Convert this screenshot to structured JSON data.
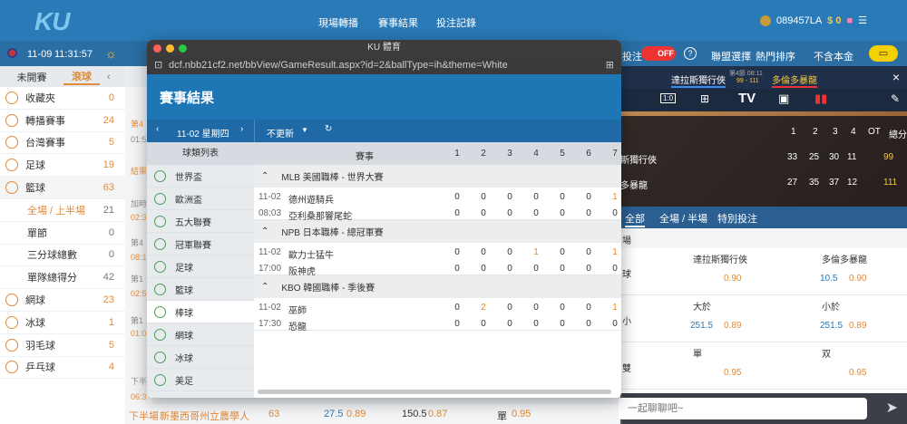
{
  "header": {
    "logo_a": "K",
    "logo_b": "U",
    "nav": [
      "現場轉播",
      "賽事結果",
      "投注記錄"
    ],
    "account": "089457LA",
    "money": "$ 0",
    "coin_label": "鋼"
  },
  "subbar": {
    "flag": "TW",
    "date": "11-09",
    "time": "11:31:57",
    "bet_label": "投注",
    "toggle": "OFF",
    "help": "?",
    "filter": "聯盟選擇",
    "sort": "熱門排序",
    "currency": "不含本金"
  },
  "sidebar": {
    "tab_upcoming": "未開賽",
    "tab_live": "滾球",
    "items": [
      {
        "label": "收藏夾",
        "count": "0",
        "icon": "star-icon"
      },
      {
        "label": "轉播賽事",
        "count": "24",
        "icon": "tv-icon"
      },
      {
        "label": "台灣賽事",
        "count": "5",
        "icon": "flag-icon"
      },
      {
        "label": "足球",
        "count": "19",
        "icon": "soccer-icon"
      },
      {
        "label": "籃球",
        "count": "63",
        "icon": "basketball-icon"
      }
    ],
    "sub": [
      {
        "label": "全場 / 上半場",
        "count": "21"
      },
      {
        "label": "單節",
        "count": "0"
      },
      {
        "label": "三分球總數",
        "count": "0"
      },
      {
        "label": "單隊總得分",
        "count": "42"
      }
    ],
    "items2": [
      {
        "label": "網球",
        "count": "23",
        "icon": "tennis-icon"
      },
      {
        "label": "冰球",
        "count": "1",
        "icon": "hockey-icon"
      },
      {
        "label": "羽毛球",
        "count": "5",
        "icon": "badminton-icon"
      },
      {
        "label": "乒乓球",
        "count": "4",
        "icon": "pingpong-icon"
      }
    ]
  },
  "midcol": [
    "第4",
    "01:5",
    "結果",
    "加時",
    "02:3",
    "第4",
    "08:1",
    "第1",
    "02:5",
    "第1",
    "01:0",
    "下半",
    "06:3"
  ],
  "bottom": {
    "stage": "下半場",
    "team": "新墨西哥州立農學人",
    "count": "63",
    "o1": "27.5",
    "o2": "0.89",
    "o3": "150.5",
    "o4": "0.87",
    "o5": "單",
    "o6": "0.95"
  },
  "window": {
    "title": "KU 體育",
    "url": "dcf.nbb21cf2.net/bbView/GameResult.aspx?id=2&ballType=ih&theme=White",
    "heading": "賽事結果",
    "date": "11-02 星期四",
    "refresh": "不更新",
    "cat_header": "球類列表",
    "cats": [
      "世界盃",
      "歐洲盃",
      "五大聯賽",
      "冠軍聯賽",
      "足球",
      "籃球",
      "棒球",
      "網球",
      "冰球",
      "美足"
    ],
    "selected_cat": "棒球",
    "res_header": "賽事",
    "cols": [
      "1",
      "2",
      "3",
      "4",
      "5",
      "6",
      "7"
    ],
    "leagues": [
      {
        "name": "MLB 美國職棒 - 世界大賽",
        "games": [
          {
            "date": "11-02",
            "time": "08:03",
            "home": "德州遊騎兵",
            "away": "亞利桑那響尾蛇",
            "h": [
              "0",
              "0",
              "0",
              "0",
              "0",
              "0",
              "1"
            ],
            "a": [
              "0",
              "0",
              "0",
              "0",
              "0",
              "0",
              "0"
            ]
          }
        ]
      },
      {
        "name": "NPB 日本職棒 - 總冠軍賽",
        "games": [
          {
            "date": "11-02",
            "time": "17:00",
            "home": "歐力士猛牛",
            "away": "阪神虎",
            "h": [
              "0",
              "0",
              "0",
              "1",
              "0",
              "0",
              "1"
            ],
            "a": [
              "0",
              "0",
              "0",
              "0",
              "0",
              "0",
              "0"
            ]
          }
        ]
      },
      {
        "name": "KBO 韓國職棒 - 季後賽",
        "games": [
          {
            "date": "11-02",
            "time": "17:30",
            "home": "巫師",
            "away": "恐龍",
            "h": [
              "0",
              "2",
              "0",
              "0",
              "0",
              "0",
              "1"
            ],
            "a": [
              "0",
              "0",
              "0",
              "0",
              "0",
              "0",
              "0"
            ]
          }
        ]
      }
    ]
  },
  "right": {
    "team1": "達拉斯獨行俠",
    "team2": "多倫多暴龍",
    "period": "第4節 08:11",
    "live": "99 - 111",
    "cols": [
      "1",
      "2",
      "3",
      "4",
      "OT",
      "總分"
    ],
    "row1": {
      "name": "斯獨行俠",
      "q": [
        "33",
        "25",
        "30",
        "11",
        ""
      ],
      "total": "99"
    },
    "row2": {
      "name": "多暴龍",
      "q": [
        "27",
        "35",
        "37",
        "12",
        ""
      ],
      "total": "111"
    },
    "tabs": [
      "全部",
      "全場 / 半場",
      "特別投注"
    ],
    "section": "場",
    "markets": [
      {
        "side": "球",
        "l": "達拉斯獨行俠",
        "r": "多倫多暴龍",
        "lv": "",
        "lo": "0.90",
        "rv": "10.5",
        "ro": "0.90"
      },
      {
        "side": "小",
        "l": "大於",
        "r": "小於",
        "lv": "251.5",
        "lo": "0.89",
        "rv": "251.5",
        "ro": "0.89"
      },
      {
        "side": "雙",
        "l": "單",
        "r": "双",
        "lv": "",
        "lo": "0.95",
        "rv": "",
        "ro": "0.95"
      }
    ],
    "chat_placeholder": "一起聊聊吧~"
  }
}
